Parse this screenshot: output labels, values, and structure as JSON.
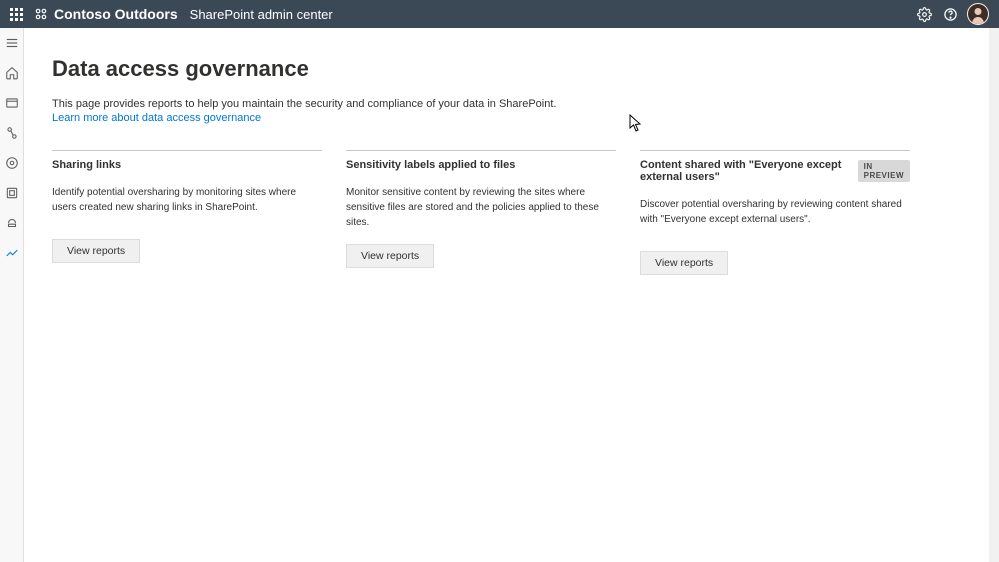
{
  "header": {
    "org_name": "Contoso Outdoors",
    "admin_center": "SharePoint admin center"
  },
  "page": {
    "title": "Data access governance",
    "description": "This page provides reports to help you maintain the security and compliance of your data in SharePoint.",
    "link": "Learn more about data access governance"
  },
  "cards": {
    "sharing": {
      "title": "Sharing links",
      "desc": "Identify potential oversharing by monitoring sites where users created new sharing links in SharePoint.",
      "button": "View reports"
    },
    "sensitivity": {
      "title": "Sensitivity labels applied to files",
      "desc": "Monitor sensitive content by reviewing the sites where sensitive files are stored and the policies applied to these sites.",
      "button": "View reports"
    },
    "everyone": {
      "title": "Content shared with \"Everyone except external users\"",
      "badge": "IN PREVIEW",
      "desc": "Discover potential oversharing by reviewing content shared with \"Everyone except external users\".",
      "button": "View reports"
    }
  }
}
